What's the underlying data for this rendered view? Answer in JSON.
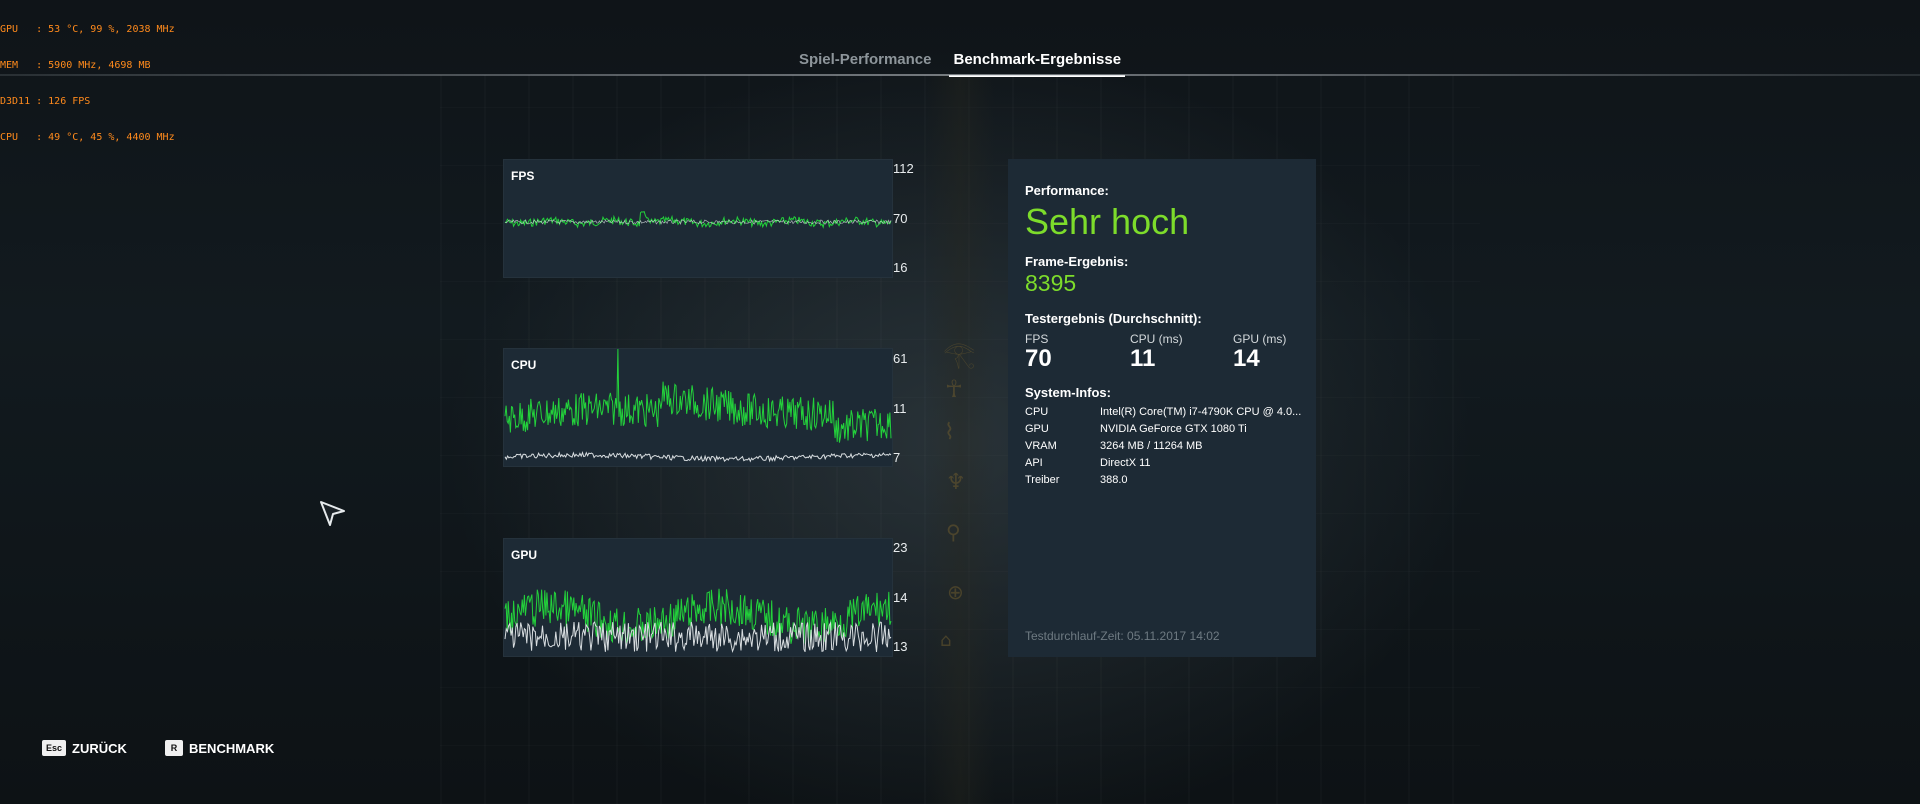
{
  "overlay": {
    "lines": [
      "GPU   : 53 °C, 99 %, 2038 MHz",
      "MEM   : 5900 MHz, 4698 MB",
      "D3D11 : 126 FPS",
      "CPU   : 49 °C, 45 %, 4400 MHz"
    ]
  },
  "tabs": [
    {
      "label": "Spiel-Performance",
      "active": false
    },
    {
      "label": "Benchmark-Ergebnisse",
      "active": true
    }
  ],
  "graphs": {
    "fps": {
      "label": "FPS",
      "axis": [
        "112",
        "70",
        "16"
      ]
    },
    "cpu": {
      "label": "CPU",
      "axis": [
        "61",
        "11",
        "7"
      ]
    },
    "gpu": {
      "label": "GPU",
      "axis": [
        "23",
        "14",
        "13"
      ]
    }
  },
  "panel": {
    "performance_label": "Performance:",
    "performance_value": "Sehr hoch",
    "frame_label": "Frame-Ergebnis:",
    "frame_value": "8395",
    "test_label": "Testergebnis (Durchschnitt):",
    "stats": [
      {
        "label": "FPS",
        "value": "70"
      },
      {
        "label": "CPU (ms)",
        "value": "11"
      },
      {
        "label": "GPU (ms)",
        "value": "14"
      }
    ],
    "system_label": "System-Infos:",
    "system": [
      {
        "key": "CPU",
        "value": "Intel(R) Core(TM) i7-4790K CPU @ 4.0..."
      },
      {
        "key": "GPU",
        "value": "NVIDIA GeForce GTX 1080 Ti"
      },
      {
        "key": "VRAM",
        "value": "3264 MB / 11264 MB"
      },
      {
        "key": "API",
        "value": "DirectX 11"
      },
      {
        "key": "Treiber",
        "value": "388.0"
      }
    ],
    "test_time": "Testdurchlauf-Zeit: 05.11.2017 14:02"
  },
  "footer": {
    "back_key": "Esc",
    "back_label": "ZURÜCK",
    "bench_key": "R",
    "bench_label": "BENCHMARK"
  },
  "colors": {
    "accent_green": "#7ddc2b",
    "graph_green": "#23d13b",
    "graph_white": "#d8dde0",
    "overlay_orange": "#ff8a1c",
    "panel_bg": "#1d2a35"
  }
}
